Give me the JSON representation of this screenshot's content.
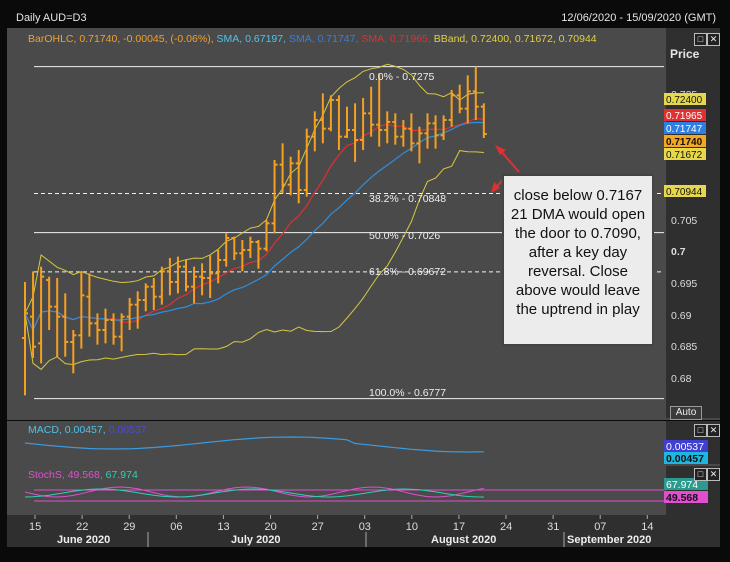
{
  "header": {
    "title": "Daily AUD=D3",
    "date_range": "12/06/2020 - 15/09/2020 (GMT)"
  },
  "legend": {
    "barohlc_label": "BarOHLC,",
    "barohlc_vals": "0.71740, -0.00045, (-0.06%),",
    "sma1_label": "SMA,",
    "sma1_val": "0.67197,",
    "sma2_label": "SMA,",
    "sma2_val": "0.71747,",
    "sma3_label": "SMA,",
    "sma3_val": "0.71965,",
    "bband_label": "BBand,",
    "bband_vals": "0.72400, 0.71672, 0.70944",
    "colors": {
      "barohlc": "#f0a030",
      "sma1": "#4fc3e8",
      "sma2": "#3a7fd8",
      "sma3": "#e03030",
      "bband": "#e0d040"
    }
  },
  "price_axis": {
    "title": "Price",
    "ticks": [
      "0.725",
      "0.7",
      "0.715",
      "0.71",
      "0.705",
      "0.7",
      "0.695",
      "0.69",
      "0.685",
      "0.68"
    ],
    "tag_bband_upper": "0.72400",
    "tag_sma_red": "0.71965",
    "tag_sma_blue": "0.71747",
    "tag_close": "0.71740",
    "tag_bband_mid": "0.71672",
    "tag_bband_lower": "0.70944",
    "auto_label": "Auto"
  },
  "fib_labels": {
    "f0": "0.0% - 0.7275",
    "f382": "38.2% - 0.70848",
    "f50": "50.0% - 0.7026",
    "f618": "61.8% - 0.69672",
    "f100": "100.0% - 0.6777"
  },
  "annotation": "close below 0.7167 21 DMA would open the door to 0.7090, after a key day reversal. Close above would leave the uptrend in play",
  "macd": {
    "label": "MACD,",
    "val1": "0.00457,",
    "val2": "0.00537",
    "tag1": "0.00537",
    "tag2": "0.00457"
  },
  "stoch": {
    "label": "StochS,",
    "val1": "49.568,",
    "val2": "67.974",
    "tag1": "67.974",
    "tag2": "49.568"
  },
  "x_axis": {
    "day_ticks": [
      "15",
      "22",
      "29",
      "06",
      "13",
      "20",
      "27",
      "03",
      "10",
      "17",
      "24",
      "31",
      "07",
      "14"
    ],
    "months": [
      "June 2020",
      "July 2020",
      "August 2020",
      "September 2020"
    ]
  },
  "chart_data": {
    "type": "ohlc",
    "ylim": [
      0.676,
      0.7285
    ],
    "fib_levels": [
      0.7275,
      0.70848,
      0.7026,
      0.69672,
      0.6777
    ],
    "bars": [
      {
        "o": 0.6868,
        "h": 0.6952,
        "l": 0.6782,
        "c": 0.6905
      },
      {
        "o": 0.69,
        "h": 0.6968,
        "l": 0.6838,
        "c": 0.6855
      },
      {
        "o": 0.686,
        "h": 0.6975,
        "l": 0.683,
        "c": 0.696
      },
      {
        "o": 0.6955,
        "h": 0.696,
        "l": 0.688,
        "c": 0.6915
      },
      {
        "o": 0.6915,
        "h": 0.6958,
        "l": 0.684,
        "c": 0.69
      },
      {
        "o": 0.69,
        "h": 0.6935,
        "l": 0.684,
        "c": 0.6862
      },
      {
        "o": 0.6862,
        "h": 0.688,
        "l": 0.6815,
        "c": 0.6872
      },
      {
        "o": 0.6872,
        "h": 0.6968,
        "l": 0.6852,
        "c": 0.6932
      },
      {
        "o": 0.693,
        "h": 0.6965,
        "l": 0.687,
        "c": 0.689
      },
      {
        "o": 0.689,
        "h": 0.6905,
        "l": 0.6858,
        "c": 0.688
      },
      {
        "o": 0.688,
        "h": 0.6912,
        "l": 0.686,
        "c": 0.6895
      },
      {
        "o": 0.6895,
        "h": 0.6905,
        "l": 0.6858,
        "c": 0.687
      },
      {
        "o": 0.687,
        "h": 0.6905,
        "l": 0.6848,
        "c": 0.69
      },
      {
        "o": 0.69,
        "h": 0.6928,
        "l": 0.688,
        "c": 0.6918
      },
      {
        "o": 0.6918,
        "h": 0.6938,
        "l": 0.6882,
        "c": 0.6925
      },
      {
        "o": 0.6925,
        "h": 0.695,
        "l": 0.6908,
        "c": 0.6945
      },
      {
        "o": 0.6945,
        "h": 0.6958,
        "l": 0.691,
        "c": 0.693
      },
      {
        "o": 0.693,
        "h": 0.6975,
        "l": 0.6918,
        "c": 0.6968
      },
      {
        "o": 0.6968,
        "h": 0.6988,
        "l": 0.6932,
        "c": 0.6952
      },
      {
        "o": 0.6952,
        "h": 0.699,
        "l": 0.6935,
        "c": 0.6975
      },
      {
        "o": 0.6975,
        "h": 0.6985,
        "l": 0.6938,
        "c": 0.6945
      },
      {
        "o": 0.6945,
        "h": 0.6975,
        "l": 0.692,
        "c": 0.696
      },
      {
        "o": 0.696,
        "h": 0.698,
        "l": 0.6932,
        "c": 0.6958
      },
      {
        "o": 0.6958,
        "h": 0.6992,
        "l": 0.6928,
        "c": 0.6965
      },
      {
        "o": 0.6965,
        "h": 0.7,
        "l": 0.695,
        "c": 0.6985
      },
      {
        "o": 0.6985,
        "h": 0.7025,
        "l": 0.6975,
        "c": 0.7018
      },
      {
        "o": 0.7018,
        "h": 0.702,
        "l": 0.6985,
        "c": 0.6995
      },
      {
        "o": 0.6995,
        "h": 0.7015,
        "l": 0.6968,
        "c": 0.7
      },
      {
        "o": 0.7,
        "h": 0.702,
        "l": 0.6988,
        "c": 0.7012
      },
      {
        "o": 0.7012,
        "h": 0.7015,
        "l": 0.6972,
        "c": 0.7002
      },
      {
        "o": 0.7002,
        "h": 0.7045,
        "l": 0.6998,
        "c": 0.704
      },
      {
        "o": 0.704,
        "h": 0.7135,
        "l": 0.7025,
        "c": 0.7128
      },
      {
        "o": 0.7128,
        "h": 0.716,
        "l": 0.7085,
        "c": 0.7098
      },
      {
        "o": 0.7098,
        "h": 0.714,
        "l": 0.7082,
        "c": 0.713
      },
      {
        "o": 0.713,
        "h": 0.715,
        "l": 0.707,
        "c": 0.709
      },
      {
        "o": 0.709,
        "h": 0.7182,
        "l": 0.708,
        "c": 0.717
      },
      {
        "o": 0.717,
        "h": 0.7208,
        "l": 0.7148,
        "c": 0.7195
      },
      {
        "o": 0.7195,
        "h": 0.7235,
        "l": 0.716,
        "c": 0.7182
      },
      {
        "o": 0.7182,
        "h": 0.7232,
        "l": 0.7178,
        "c": 0.7225
      },
      {
        "o": 0.7225,
        "h": 0.7232,
        "l": 0.715,
        "c": 0.717
      },
      {
        "o": 0.717,
        "h": 0.7215,
        "l": 0.7168,
        "c": 0.718
      },
      {
        "o": 0.718,
        "h": 0.722,
        "l": 0.7132,
        "c": 0.7165
      },
      {
        "o": 0.7165,
        "h": 0.7228,
        "l": 0.715,
        "c": 0.7205
      },
      {
        "o": 0.7205,
        "h": 0.7245,
        "l": 0.717,
        "c": 0.7188
      },
      {
        "o": 0.7188,
        "h": 0.7265,
        "l": 0.7155,
        "c": 0.718
      },
      {
        "o": 0.718,
        "h": 0.7208,
        "l": 0.716,
        "c": 0.7192
      },
      {
        "o": 0.7192,
        "h": 0.7205,
        "l": 0.7158,
        "c": 0.717
      },
      {
        "o": 0.717,
        "h": 0.7195,
        "l": 0.7155,
        "c": 0.7182
      },
      {
        "o": 0.7182,
        "h": 0.7205,
        "l": 0.7148,
        "c": 0.716
      },
      {
        "o": 0.716,
        "h": 0.7185,
        "l": 0.713,
        "c": 0.7175
      },
      {
        "o": 0.7175,
        "h": 0.7205,
        "l": 0.7152,
        "c": 0.719
      },
      {
        "o": 0.719,
        "h": 0.7202,
        "l": 0.7152,
        "c": 0.7172
      },
      {
        "o": 0.7172,
        "h": 0.7202,
        "l": 0.7165,
        "c": 0.7195
      },
      {
        "o": 0.7195,
        "h": 0.724,
        "l": 0.7185,
        "c": 0.7232
      },
      {
        "o": 0.7232,
        "h": 0.7248,
        "l": 0.7205,
        "c": 0.7212
      },
      {
        "o": 0.7212,
        "h": 0.7262,
        "l": 0.719,
        "c": 0.7238
      },
      {
        "o": 0.7238,
        "h": 0.7275,
        "l": 0.7195,
        "c": 0.7215
      },
      {
        "o": 0.7215,
        "h": 0.722,
        "l": 0.7168,
        "c": 0.7174
      }
    ]
  }
}
